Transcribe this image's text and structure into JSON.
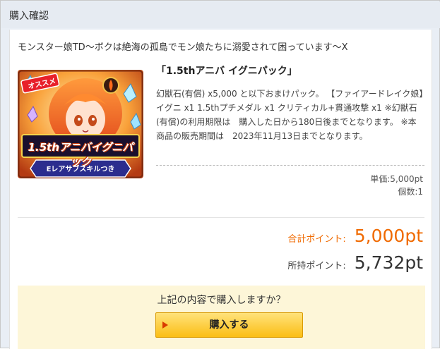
{
  "window": {
    "title": "購入確認"
  },
  "game": {
    "title": "モンスター娘TD〜ボクは絶海の孤島でモン娘たちに溺愛されて困っています〜X"
  },
  "product": {
    "image": {
      "badge": "オススメ",
      "banner": "1.5thアニバイグニパック",
      "ribbon": "Eレアサブスキルつき",
      "icon": "pack-thumbnail-image"
    },
    "name": "「1.5thアニバ イグニパック」",
    "description": "幻獣石(有償) x5,000 と以下おまけパック。 【ファイアードレイク娘】イグニ x1 1.5thプチメダル x1 クリティカル+貫通攻撃 x1 ※幻獣石(有償)の利用期限は　購入した日から180日後までとなります。 ※本商品の販売期間は　2023年11月13日までとなります。",
    "unit_price": "単価:5,000pt",
    "quantity": "個数:1"
  },
  "totals": {
    "total_label": "合計ポイント:",
    "total_value": "5,000pt",
    "owned_label": "所持ポイント:",
    "owned_value": "5,732pt"
  },
  "confirm": {
    "question": "上記の内容で購入しますか？",
    "buy_label": "購入する"
  },
  "colors": {
    "accent": "#f06a00",
    "button": "#fbbe14",
    "confirm_bg": "#fdf6d8"
  }
}
